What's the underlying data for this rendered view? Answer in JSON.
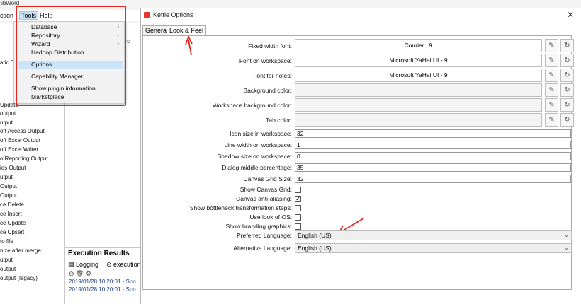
{
  "app": {
    "title": "ibWord"
  },
  "menubar": {
    "edit": "ction",
    "tools": "Tools",
    "help": "Help"
  },
  "tools_menu": {
    "items": [
      {
        "label": "Database",
        "submenu": true
      },
      {
        "label": "Repository",
        "submenu": true
      },
      {
        "label": "Wizard",
        "submenu": true
      },
      {
        "label": "Hadoop Distribution..."
      },
      {
        "label": "Options..."
      },
      {
        "label": "Capability Manager"
      },
      {
        "label": "Show plugin information..."
      },
      {
        "label": "Marketplace"
      }
    ]
  },
  "left_panel": {
    "items": [
      "atic Di",
      "Update",
      "output",
      "utput",
      "oft Access Output",
      "oft Excel Output",
      "oft Excel Writer",
      "o Reporting Output",
      "ies Output",
      "utput",
      "Output",
      "Output",
      "ce Delete",
      "ce Insert",
      "ce Update",
      "ce Upsert",
      "to file",
      "nize after merge",
      "utput",
      "output",
      "output (legacy)"
    ]
  },
  "canvas": {
    "tab_text": "urc"
  },
  "execution": {
    "title": "Execution Results",
    "tab_logging": "Logging",
    "tab_execution": "execution",
    "log_lines": [
      "2019/01/28 10:20:01 - Spo",
      "2019/01/28 10:20:01 - Spo"
    ]
  },
  "dialog": {
    "title": "Kettle Options",
    "tabs": [
      "General",
      "Look & Feel"
    ],
    "font_rows": [
      {
        "label": "Fixed width font:",
        "value": "Courier , 9"
      },
      {
        "label": "Font on workspace:",
        "value": "Microsoft YaHei UI - 9"
      },
      {
        "label": "Font for notes:",
        "value": "Microsoft YaHei UI - 9"
      },
      {
        "label": "Background color:",
        "value": ""
      },
      {
        "label": "Workspace background color:",
        "value": ""
      },
      {
        "label": "Tab color:",
        "value": ""
      }
    ],
    "text_rows": [
      {
        "label": "Icon size in workspace:",
        "value": "32"
      },
      {
        "label": "Line width on workspace:",
        "value": "1"
      },
      {
        "label": "Shadow size on workspace:",
        "value": "0"
      },
      {
        "label": "Dialog middle percentage:",
        "value": "35"
      },
      {
        "label": "Canvas Grid Size:",
        "value": "32"
      }
    ],
    "check_rows": [
      {
        "label": "Show Canvas Grid:",
        "checked": false
      },
      {
        "label": "Canvas anti-aliasing:",
        "checked": true
      },
      {
        "label": "Show bottleneck transformation steps:",
        "checked": false
      },
      {
        "label": "Use look of OS:",
        "checked": false
      },
      {
        "label": "Show branding graphics:",
        "checked": false
      }
    ],
    "select_rows": [
      {
        "label": "Preferred Language:",
        "value": "English (US)"
      },
      {
        "label": "Alternative Language:",
        "value": "English (US)"
      }
    ]
  },
  "colors": {
    "highlight": "#cce4f7",
    "annotation_red": "#e8261b",
    "dialog_icon": "#e6382c"
  },
  "icons": {
    "edit": "pencil-icon",
    "reset": "refresh-icon",
    "close": "close-icon"
  }
}
